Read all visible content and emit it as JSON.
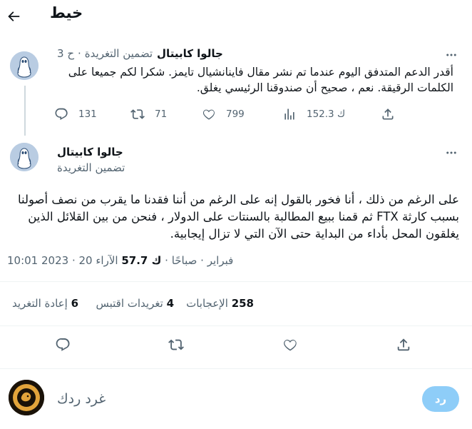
{
  "header": {
    "title": "خيط"
  },
  "tweet1": {
    "author_name": "جالوا كابيتال",
    "handle": "تضمين التغريدة",
    "separator": "·",
    "time": "ح 3",
    "text": "أقدر الدعم المتدفق اليوم عندما تم نشر مقال فاينانشيال تايمز. شكرا لكم جميعا على الكلمات الرقيقة. نعم ، صحيح أن صندوقنا الرئيسي يغلق.",
    "replies": "131",
    "retweets": "71",
    "likes": "799",
    "views": "ك 152.3"
  },
  "tweet2": {
    "author_name": "جالوا كابيتال",
    "handle": "تضمين التغريدة",
    "text": "على الرغم من ذلك ، أنا فخور بالقول إنه على الرغم من أننا فقدنا ما يقرب من نصف أصولنا بسبب كارثة FTX ثم قمنا ببيع المطالبة بالسنتات على الدولار ، فنحن من بين القلائل الذين يغلقون المحل بأداء من البداية حتى الآن التي لا تزال إيجابية.",
    "time": "10:01 2023",
    "date": "20 فبراير",
    "period": "صباحًا",
    "dot": "·",
    "views_count": "ك 57.7",
    "views_label": "الآراء",
    "retweets_count": "6",
    "retweets_label": "إعادة التغريد",
    "quotes_count": "4",
    "quotes_label": "تغريدات اقتبس",
    "likes_count": "258",
    "likes_label": "الإعجابات"
  },
  "reply": {
    "placeholder": "غرد ردك",
    "button_label": "رد"
  },
  "colors": {
    "accent_disabled": "#8ecdf8",
    "gray_text": "#536471",
    "divider": "#eff3f4"
  }
}
